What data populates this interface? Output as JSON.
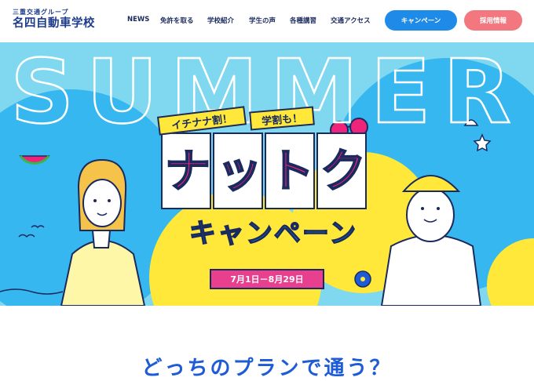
{
  "header": {
    "logo_sub": "三重交通グループ",
    "logo_main": "名四自動車学校",
    "nav": [
      "NEWS",
      "免許を取る",
      "学校紹介",
      "学生の声",
      "各種講習",
      "交通アクセス"
    ],
    "campaign_button": "キャンペーン",
    "recruit_button": "採用情報"
  },
  "hero": {
    "background_word": "SUMMER",
    "tag_1": "イチナナ割！",
    "tag_2": "学割も！",
    "title": "ナットク",
    "subtitle": "キャンペーン",
    "period": "7月1日－8月29日"
  },
  "section": {
    "heading": "どっちのプランで通う？"
  },
  "colors": {
    "navy": "#1a2a5e",
    "sky": "#7fd8ef",
    "blue_button": "#1e8be8",
    "pink_button": "#f2777f",
    "title_pink": "#f0237a",
    "yellow": "#ffe83a"
  }
}
